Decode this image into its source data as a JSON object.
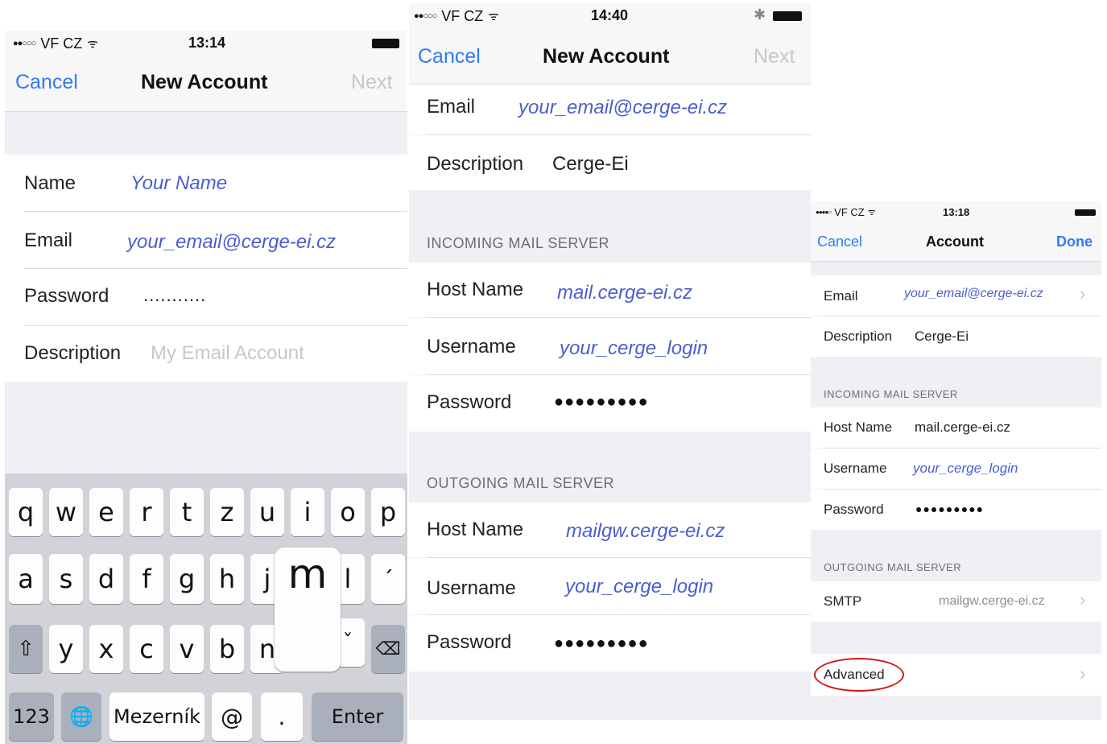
{
  "screen1": {
    "status": {
      "signal": "●●○○○",
      "carrier": "VF CZ",
      "wifi": "ᯤ",
      "time": "13:14"
    },
    "nav": {
      "cancel": "Cancel",
      "title": "New Account",
      "next": "Next"
    },
    "fields": [
      {
        "label": "Name",
        "value": "Your Name"
      },
      {
        "label": "Email",
        "value": "your_email@cerge-ei.cz"
      },
      {
        "label": "Password",
        "value": "..........."
      },
      {
        "label": "Description",
        "placeholder": "My Email Account"
      }
    ],
    "keyboard": {
      "row1": [
        "q",
        "w",
        "e",
        "r",
        "t",
        "z",
        "u",
        "i",
        "o",
        "p"
      ],
      "row2": [
        "a",
        "s",
        "d",
        "f",
        "g",
        "h",
        "j",
        "m",
        "l",
        "´"
      ],
      "row3": [
        "⇧",
        "y",
        "x",
        "c",
        "v",
        "b",
        "n",
        "ˇ",
        "⌫"
      ],
      "row4": [
        "123",
        "🌐",
        "Mezerník",
        "@",
        ".",
        "Enter"
      ],
      "popup_key": "m"
    }
  },
  "screen2": {
    "status": {
      "signal": "●●○○○",
      "carrier": "VF CZ",
      "wifi": "ᯤ",
      "time": "14:40",
      "bluetooth": "✱"
    },
    "nav": {
      "cancel": "Cancel",
      "title": "New Account",
      "next": "Next"
    },
    "email": {
      "label": "Email",
      "value": "your_email@cerge-ei.cz"
    },
    "description": {
      "label": "Description",
      "value": "Cerge-Ei"
    },
    "incoming": {
      "header": "INCOMING MAIL SERVER",
      "host": {
        "label": "Host Name",
        "value": "mail.cerge-ei.cz"
      },
      "user": {
        "label": "Username",
        "value": "your_cerge_login"
      },
      "password": {
        "label": "Password",
        "value": "●●●●●●●●●"
      }
    },
    "outgoing": {
      "header": "OUTGOING MAIL SERVER",
      "host": {
        "label": "Host Name",
        "value": "mailgw.cerge-ei.cz"
      },
      "user": {
        "label": "Username",
        "value": "your_cerge_login"
      },
      "password": {
        "label": "Password",
        "value": "●●●●●●●●●"
      }
    }
  },
  "screen3": {
    "status": {
      "signal": "●●●●○",
      "carrier": "VF CZ",
      "wifi": "ᯤ",
      "time": "13:18"
    },
    "nav": {
      "cancel": "Cancel",
      "title": "Account",
      "done": "Done"
    },
    "email": {
      "label": "Email",
      "value": "your_email@cerge-ei.cz",
      "chevron": "›"
    },
    "description": {
      "label": "Description",
      "value": "Cerge-Ei"
    },
    "incoming": {
      "header": "INCOMING MAIL SERVER",
      "host": {
        "label": "Host Name",
        "value": "mail.cerge-ei.cz"
      },
      "user": {
        "label": "Username",
        "value": "your_cerge_login"
      },
      "password": {
        "label": "Password",
        "value": "●●●●●●●●●"
      }
    },
    "outgoing": {
      "header": "OUTGOING MAIL SERVER",
      "smtp": {
        "label": "SMTP",
        "value": "mailgw.cerge-ei.cz",
        "chevron": "›"
      }
    },
    "advanced": {
      "label": "Advanced",
      "chevron": "›",
      "highlight_color": "#d11a1a"
    }
  },
  "colors": {
    "accent": "#2f7bf5",
    "value_blue": "#4a5ed0",
    "group_bg": "#efeff4"
  }
}
